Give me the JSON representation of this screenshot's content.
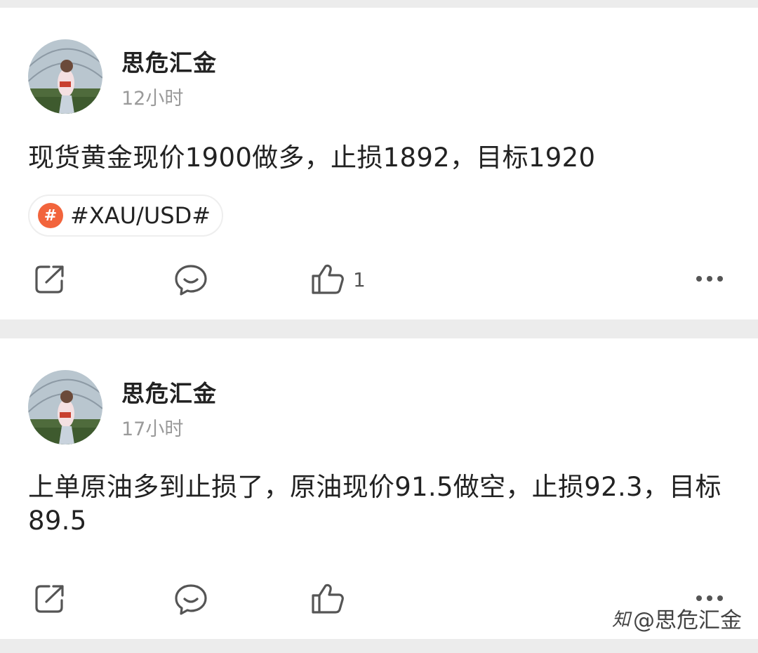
{
  "posts": [
    {
      "author": "思危汇金",
      "time": "12小时",
      "content": "现货黄金现价1900做多，止损1892，目标1920",
      "tag": "#XAU/USD#",
      "tag_icon": "#",
      "likes": "1"
    },
    {
      "author": "思危汇金",
      "time": "17小时",
      "content": "上单原油多到止损了，原油现价91.5做空，止损92.3，目标89.5"
    }
  ],
  "watermark": {
    "logo": "知",
    "text": "@思危汇金"
  },
  "icons": {
    "share": "share-icon",
    "comment": "comment-icon",
    "like": "thumbs-up-icon",
    "more": "more-dots-icon"
  }
}
